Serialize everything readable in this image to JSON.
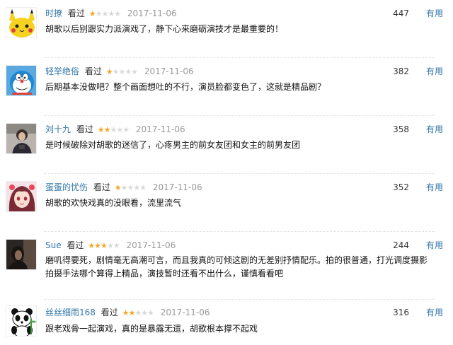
{
  "watched_label": "看过",
  "useful_label": "有用",
  "colors": {
    "link": "#3377aa",
    "star_on": "#f5a623",
    "star_off": "#d9d9d9",
    "date": "#999999"
  },
  "comments": [
    {
      "user": "时撩",
      "rating": 1,
      "date": "2017-11-06",
      "votes": "447",
      "text": "胡歌以后别跟实力派演戏了，静下心来磨砺演技才是最重要的！",
      "avatar": "pikachu-avatar"
    },
    {
      "user": "轻举绝俗",
      "rating": 1,
      "date": "2017-11-06",
      "votes": "382",
      "text": "后期基本没做吧？整个画面想吐的不行，演员脸都变色了，这就是精品剧？",
      "avatar": "doraemon-avatar"
    },
    {
      "user": "刘十九",
      "rating": 2,
      "date": "2017-11-06",
      "votes": "358",
      "text": "是时候破除对胡歌的迷信了，心疼男主的前女友团和女主的前男友团",
      "avatar": "photo-avatar"
    },
    {
      "user": "蛋蛋的忧伤",
      "rating": 1,
      "date": "2017-11-06",
      "votes": "352",
      "text": "胡歌的欢快戏真的没眼看，流里流气",
      "avatar": "anime-girl-avatar"
    },
    {
      "user": "Sue",
      "rating": 3,
      "date": "2017-11-06",
      "votes": "244",
      "text": "磨叽得要死，剧情毫无高潮可言，而且我真的可倾这剧的无差别抒情配乐。拍的很普通，打光调度摄影拍摄手法哪个算得上精品，演技暂时还看不出什么，谨慎看看吧",
      "avatar": "dark-photo-avatar"
    },
    {
      "user": "丝丝细雨168",
      "rating": 2,
      "date": "2017-11-06",
      "votes": "316",
      "text": "跟老戏骨一起演戏，真的是暴露无遗，胡歌根本撑不起戏",
      "avatar": "panda-avatar"
    }
  ]
}
